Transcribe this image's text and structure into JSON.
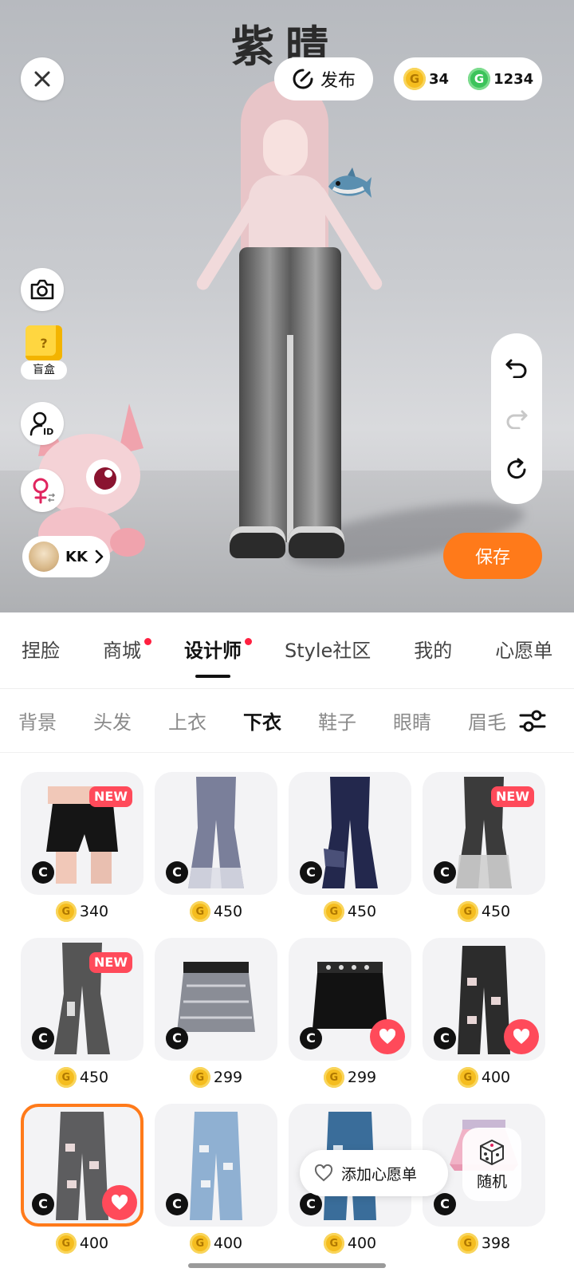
{
  "header": {
    "title_art": "紫晴",
    "publish_label": "发布",
    "gold_coins": "34",
    "green_coins": "1234"
  },
  "side": {
    "blindbox_label": "盲盒",
    "blindbox_glyph": "?",
    "user_name": "KK"
  },
  "actions": {
    "save_label": "保存"
  },
  "tabs": [
    {
      "label": "捏脸",
      "dot": false
    },
    {
      "label": "商城",
      "dot": true
    },
    {
      "label": "设计师",
      "dot": true,
      "active": true
    },
    {
      "label": "Style社区",
      "dot": false
    },
    {
      "label": "我的",
      "dot": false
    },
    {
      "label": "心愿单",
      "dot": false
    }
  ],
  "subtabs": [
    {
      "label": "背景"
    },
    {
      "label": "头发"
    },
    {
      "label": "上衣"
    },
    {
      "label": "下衣",
      "active": true
    },
    {
      "label": "鞋子"
    },
    {
      "label": "眼睛"
    },
    {
      "label": "眉毛"
    }
  ],
  "items": [
    {
      "price": "340",
      "new": true,
      "liked": false,
      "kind": "skirt-black-slit"
    },
    {
      "price": "450",
      "new": false,
      "liked": false,
      "kind": "jeans-flare-grey"
    },
    {
      "price": "450",
      "new": false,
      "liked": false,
      "kind": "jeans-flare-navy"
    },
    {
      "price": "450",
      "new": true,
      "liked": false,
      "kind": "jeans-flare-black-fade"
    },
    {
      "price": "450",
      "new": true,
      "liked": false,
      "kind": "jeans-flare-charcoal"
    },
    {
      "price": "299",
      "new": false,
      "liked": false,
      "kind": "skirt-paisley"
    },
    {
      "price": "299",
      "new": false,
      "liked": true,
      "kind": "skirt-black-belt"
    },
    {
      "price": "400",
      "new": false,
      "liked": true,
      "kind": "jeans-ripped-black"
    },
    {
      "price": "400",
      "new": false,
      "liked": true,
      "kind": "jeans-ripped-grey",
      "selected": true
    },
    {
      "price": "400",
      "new": false,
      "liked": false,
      "kind": "jeans-ripped-light-blue"
    },
    {
      "price": "400",
      "new": false,
      "liked": false,
      "kind": "jeans-ripped-blue"
    },
    {
      "price": "398",
      "new": false,
      "liked": false,
      "kind": "skirt-pink-tutu"
    }
  ],
  "badges": {
    "new_label": "NEW",
    "creator_label": "C",
    "coin_glyph": "G"
  },
  "floating": {
    "wishlist_label": "添加心愿单",
    "random_label": "随机"
  },
  "colors": {
    "accent_orange": "#ff7a1a",
    "new_red": "#ff4a5a",
    "tab_dot": "#ff2040",
    "coin_gold": "#f5bd1f",
    "coin_green": "#3cc35a"
  }
}
